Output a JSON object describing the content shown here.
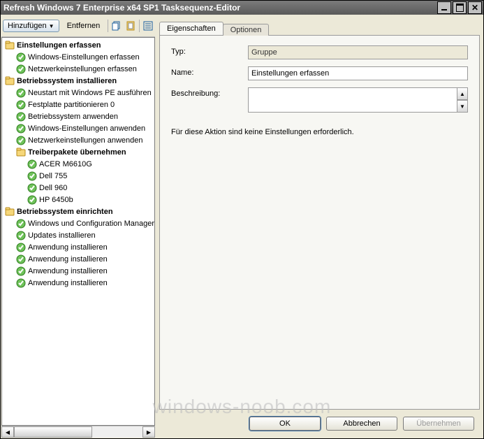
{
  "window": {
    "title": "Refresh Windows 7 Enterprise x64 SP1 Tasksequenz-Editor"
  },
  "toolbar": {
    "add": "Hinzufügen",
    "remove": "Entfernen"
  },
  "tree": {
    "g1": "Einstellungen erfassen",
    "g1_i1": "Windows-Einstellungen erfassen",
    "g1_i2": "Netzwerkeinstellungen erfassen",
    "g2": "Betriebssystem installieren",
    "g2_i1": "Neustart mit Windows PE ausführen",
    "g2_i2": "Festplatte partitionieren 0",
    "g2_i3": "Betriebssystem anwenden",
    "g2_i4": "Windows-Einstellungen anwenden",
    "g2_i5": "Netzwerkeinstellungen anwenden",
    "g2_g1": "Treiberpakete übernehmen",
    "g2_g1_i1": "ACER M6610G",
    "g2_g1_i2": "Dell 755",
    "g2_g1_i3": "Dell 960",
    "g2_g1_i4": "HP 6450b",
    "g3": "Betriebssystem einrichten",
    "g3_i1": "Windows und Configuration Manager",
    "g3_i2": "Updates installieren",
    "g3_i3": "Anwendung installieren",
    "g3_i4": "Anwendung installieren",
    "g3_i5": "Anwendung installieren",
    "g3_i6": "Anwendung installieren"
  },
  "tabs": {
    "props": "Eigenschaften",
    "opts": "Optionen"
  },
  "form": {
    "type_label": "Typ:",
    "type_value": "Gruppe",
    "name_label": "Name:",
    "name_value": "Einstellungen erfassen",
    "desc_label": "Beschreibung:",
    "desc_value": "",
    "hint": "Für diese Aktion sind keine Einstellungen erforderlich."
  },
  "buttons": {
    "ok": "OK",
    "cancel": "Abbrechen",
    "apply": "Übernehmen"
  },
  "watermark": "windows-noob.com"
}
